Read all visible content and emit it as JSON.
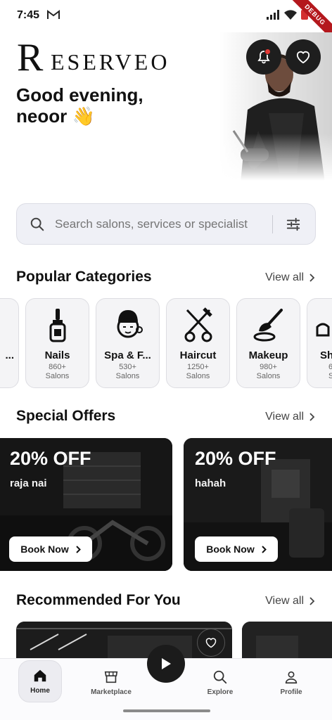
{
  "status_bar": {
    "time": "7:45",
    "debug_label": "DEBUG"
  },
  "header": {
    "logo_text": "ESERVEO",
    "logo_letter": "R",
    "greeting_line1": "Good evening,",
    "greeting_line2": "neoor 👋"
  },
  "search": {
    "placeholder": "Search salons, services or specialist"
  },
  "popular_categories": {
    "title": "Popular Categories",
    "view_all": "View all",
    "items": [
      {
        "name": "...",
        "count": "",
        "unit": "",
        "icon": "partial-icon"
      },
      {
        "name": "Nails",
        "count": "860+",
        "unit": "Salons",
        "icon": "nail-polish-icon"
      },
      {
        "name": "Spa & F...",
        "count": "530+",
        "unit": "Salons",
        "icon": "spa-face-icon"
      },
      {
        "name": "Haircut",
        "count": "1250+",
        "unit": "Salons",
        "icon": "scissors-comb-icon"
      },
      {
        "name": "Makeup",
        "count": "980+",
        "unit": "Salons",
        "icon": "makeup-brush-icon"
      },
      {
        "name": "Sh",
        "count": "6",
        "unit": "S",
        "icon": "shave-icon"
      }
    ]
  },
  "special_offers": {
    "title": "Special Offers",
    "view_all": "View all",
    "items": [
      {
        "discount": "20% OFF",
        "name": "raja nai",
        "button": "Book Now"
      },
      {
        "discount": "20% OFF",
        "name": "hahah",
        "button": "Book Now"
      }
    ]
  },
  "recommended": {
    "title": "Recommended For You",
    "view_all": "View all"
  },
  "bottom_nav": {
    "home": "Home",
    "marketplace": "Marketplace",
    "explore": "Explore",
    "profile": "Profile"
  },
  "colors": {
    "accent": "#1e1e1e",
    "notification": "#e53935",
    "debug": "#b4181d"
  }
}
